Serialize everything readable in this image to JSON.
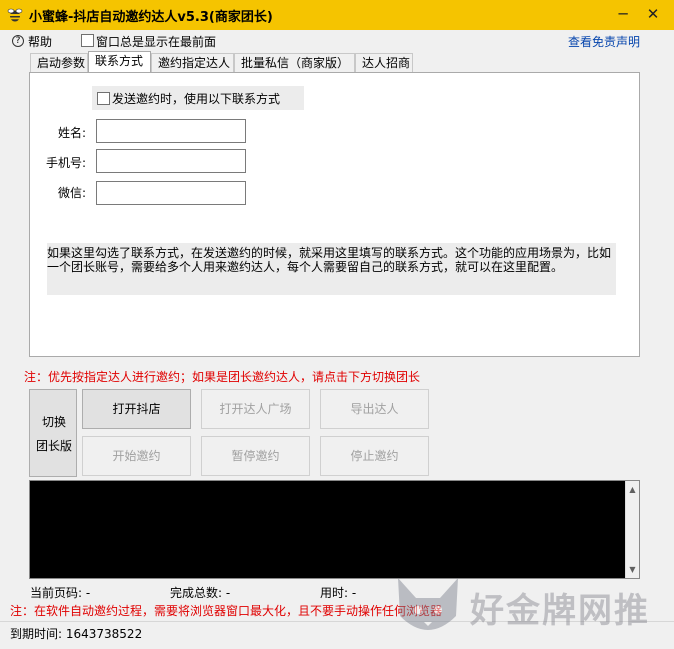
{
  "window": {
    "title": "小蜜蜂-抖店自动邀约达人v5.3(商家团长)",
    "minimize": "─",
    "close": "✕"
  },
  "helpbar": {
    "help": "帮助",
    "always_on_top": "窗口总是显示在最前面",
    "disclaimer": "查看免责声明"
  },
  "tabs": [
    "启动参数",
    "联系方式",
    "邀约指定达人",
    "批量私信（商家版）",
    "达人招商"
  ],
  "active_tab": "联系方式",
  "contact": {
    "use_contact_label": "发送邀约时，使用以下联系方式",
    "name_label": "姓名:",
    "name_value": "",
    "phone_label": "手机号:",
    "phone_value": "",
    "wechat_label": "微信:",
    "wechat_value": "",
    "hint": "如果这里勾选了联系方式，在发送邀约的时候，就采用这里填写的联系方式。这个功能的应用场景为，比如一个团长账号，需要给多个人用来邀约达人，每个人需要留自己的联系方式，就可以在这里配置。"
  },
  "notes": {
    "top": "注：优先按指定达人进行邀约；如果是团长邀约达人，请点击下方切换团长",
    "bottom": "注：在软件自动邀约过程，需要将浏览器窗口最大化，且不要手动操作任何浏览器"
  },
  "buttons": {
    "switch_line1": "切换",
    "switch_line2": "团长版",
    "open_store": "打开抖店",
    "open_plaza": "打开达人广场",
    "export": "导出达人",
    "start": "开始邀约",
    "pause": "暂停邀约",
    "stop": "停止邀约"
  },
  "console": {
    "scroll_up": "▲",
    "scroll_down": "▼"
  },
  "status": {
    "current_page": "当前页码: -",
    "total_done": "完成总数: -",
    "time_used": "用时: -"
  },
  "footer": {
    "expire": "到期时间:  1643738522"
  },
  "watermark": {
    "text": "好金牌网推"
  },
  "colors": {
    "titlebar": "#f5c400",
    "note_red": "#e00000",
    "link_blue": "#0645ad",
    "console_bg": "#000000"
  }
}
